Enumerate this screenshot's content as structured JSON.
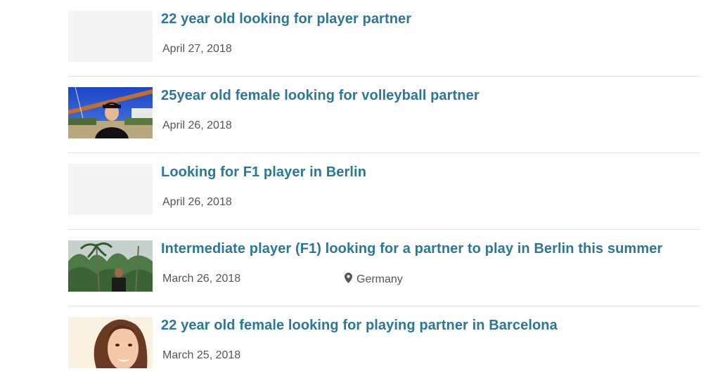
{
  "posts": [
    {
      "title": "22 year old looking for player partner",
      "date": "April 27, 2018",
      "location": "",
      "thumbnail": "placeholder"
    },
    {
      "title": "25year old female looking for volleyball partner",
      "date": "April 26, 2018",
      "location": "",
      "thumbnail": "beach-volleyball-photo"
    },
    {
      "title": "Looking for F1 player in Berlin",
      "date": "April 26, 2018",
      "location": "",
      "thumbnail": "placeholder"
    },
    {
      "title": "Intermediate player (F1) looking for a partner to play in Berlin this summer",
      "date": "March 26, 2018",
      "location": "Germany",
      "thumbnail": "palm-trees-photo"
    },
    {
      "title": "22 year old female looking for playing partner in Barcelona",
      "date": "March 25, 2018",
      "location": "",
      "thumbnail": "portrait-photo"
    }
  ],
  "colors": {
    "title": "#2a7896",
    "meta": "#555555",
    "divider": "#e2e2e2",
    "placeholder": "#f4f4f4"
  },
  "icons": {
    "location": "map-pin-icon"
  }
}
